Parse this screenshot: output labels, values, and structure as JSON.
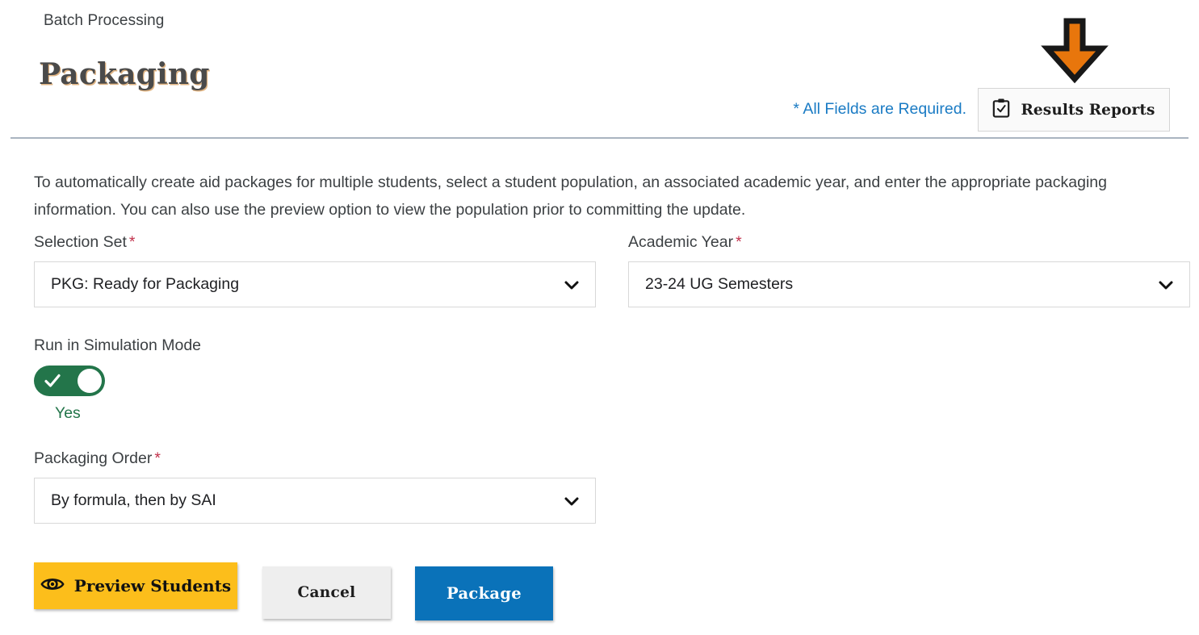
{
  "header": {
    "breadcrumb": "Batch Processing",
    "title": "Packaging",
    "required_note": "* All Fields are Required.",
    "results_reports_label": "Results Reports",
    "results_reports_icon": "clipboard-check-icon",
    "annotation_icon": "orange-down-arrow-icon",
    "annotation_color": "#e8760c"
  },
  "main": {
    "description": "To automatically create aid packages for multiple students, select a student population, an associated academic year, and enter the appropriate packaging information. You can also use the preview option to view the population prior to committing the update.",
    "required_marker": "*",
    "fields": {
      "selection_set": {
        "label": "Selection Set",
        "value": "PKG: Ready for Packaging",
        "required": true,
        "chevron_icon": "chevron-down-icon"
      },
      "academic_year": {
        "label": "Academic Year",
        "value": "23-24 UG Semesters",
        "required": true,
        "chevron_icon": "chevron-down-icon"
      },
      "simulation_mode": {
        "label": "Run in Simulation Mode",
        "value": "Yes",
        "state": "on",
        "on_color": "#23754a",
        "icon": "check-icon"
      },
      "packaging_order": {
        "label": "Packaging Order",
        "value": "By formula, then by SAI",
        "required": true,
        "chevron_icon": "chevron-down-icon"
      }
    }
  },
  "actions": {
    "preview_label": "Preview Students",
    "preview_icon": "eye-icon",
    "preview_color": "#fcbe1b",
    "cancel_label": "Cancel",
    "cancel_color": "#eeeeee",
    "package_label": "Package",
    "package_color": "#0a72b9"
  }
}
